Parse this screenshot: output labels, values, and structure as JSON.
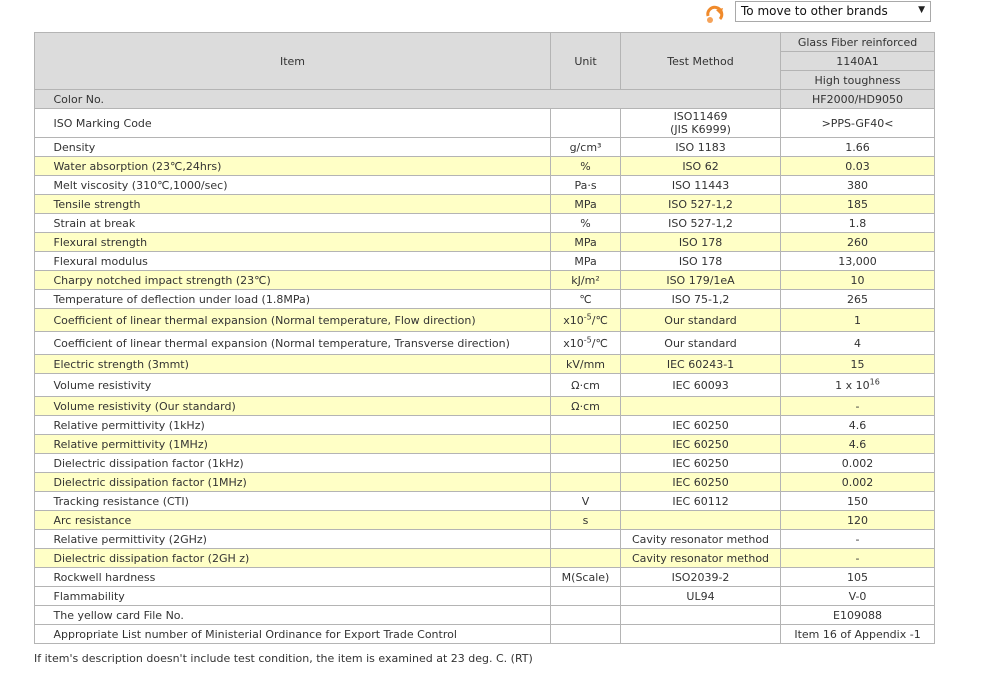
{
  "brand_selector": {
    "icon": "brand-switch-icon",
    "label": "To move to other brands",
    "arrow": "▼"
  },
  "table": {
    "headers": {
      "item": "Item",
      "unit": "Unit",
      "test_method": "Test Method",
      "grade_group": "Glass Fiber reinforced",
      "grade": "1140A1",
      "feature": "High toughness"
    },
    "color_no": {
      "item": "Color No.",
      "value": "HF2000/HD9050"
    },
    "rows": [
      {
        "item": "ISO Marking Code",
        "unit": "",
        "method": "ISO11469",
        "method_sub": "(JIS K6999)",
        "value": ">PPS-GF40<",
        "style": "white",
        "tall": true
      },
      {
        "item": "Density",
        "unit": "g/cm³",
        "method": "ISO 1183",
        "value": "1.66",
        "style": "white"
      },
      {
        "item": "Water absorption (23℃,24hrs)",
        "unit": "%",
        "method": "ISO 62",
        "value": "0.03",
        "style": "yellow"
      },
      {
        "item": "Melt viscosity (310℃,1000/sec)",
        "unit": "Pa·s",
        "method": "ISO 11443",
        "value": "380",
        "style": "white"
      },
      {
        "item": "Tensile strength",
        "unit": "MPa",
        "method": "ISO 527-1,2",
        "value": "185",
        "style": "yellow"
      },
      {
        "item": "Strain at break",
        "unit": "%",
        "method": "ISO 527-1,2",
        "value": "1.8",
        "style": "white"
      },
      {
        "item": "Flexural strength",
        "unit": "MPa",
        "method": "ISO 178",
        "value": "260",
        "style": "yellow"
      },
      {
        "item": "Flexural modulus",
        "unit": "MPa",
        "method": "ISO 178",
        "value": "13,000",
        "style": "white"
      },
      {
        "item": "Charpy notched impact strength (23℃)",
        "unit": "kJ/m²",
        "method": "ISO 179/1eA",
        "value": "10",
        "style": "yellow"
      },
      {
        "item": "Temperature of deflection under load (1.8MPa)",
        "unit": "℃",
        "method": "ISO 75-1,2",
        "value": "265",
        "style": "white"
      },
      {
        "item": "Coefficient of linear thermal expansion (Normal temperature, Flow direction)",
        "unit_base": "x10",
        "unit_exp": "-5",
        "unit_tail": "/℃",
        "method": "Our standard",
        "value": "1",
        "style": "yellow",
        "tall2": true
      },
      {
        "item": "Coefficient of linear thermal expansion (Normal temperature, Transverse direction)",
        "unit_base": "x10",
        "unit_exp": "-5",
        "unit_tail": "/℃",
        "method": "Our standard",
        "value": "4",
        "style": "white",
        "tall2": true
      },
      {
        "item": "Electric strength (3mmt)",
        "unit": "kV/mm",
        "method": "IEC 60243-1",
        "value": "15",
        "style": "yellow"
      },
      {
        "item": "Volume resistivity",
        "unit": "Ω·cm",
        "method": "IEC 60093",
        "value_base": "1 x 10",
        "value_exp": "16",
        "style": "white",
        "tall2": true
      },
      {
        "item": "Volume resistivity (Our standard)",
        "unit": "Ω·cm",
        "method": "",
        "value": "-",
        "style": "yellow"
      },
      {
        "item": "Relative permittivity (1kHz)",
        "unit": "",
        "method": "IEC 60250",
        "value": "4.6",
        "style": "white"
      },
      {
        "item": "Relative permittivity (1MHz)",
        "unit": "",
        "method": "IEC 60250",
        "value": "4.6",
        "style": "yellow"
      },
      {
        "item": "Dielectric dissipation factor (1kHz)",
        "unit": "",
        "method": "IEC 60250",
        "value": "0.002",
        "style": "white"
      },
      {
        "item": "Dielectric dissipation factor (1MHz)",
        "unit": "",
        "method": "IEC 60250",
        "value": "0.002",
        "style": "yellow"
      },
      {
        "item": "Tracking resistance (CTI)",
        "unit": "V",
        "method": "IEC 60112",
        "value": "150",
        "style": "white"
      },
      {
        "item": "Arc resistance",
        "unit": "s",
        "method": "",
        "value": "120",
        "style": "yellow"
      },
      {
        "item": "Relative permittivity (2GHz)",
        "unit": "",
        "method": "Cavity resonator method",
        "value": "-",
        "style": "white"
      },
      {
        "item": "Dielectric dissipation factor (2GH z)",
        "unit": "",
        "method": "Cavity resonator method",
        "value": "-",
        "style": "yellow"
      },
      {
        "item": "Rockwell hardness",
        "unit": "M(Scale)",
        "method": "ISO2039-2",
        "value": "105",
        "style": "white"
      },
      {
        "item": "Flammability",
        "unit": "",
        "method": "UL94",
        "value": "V-0",
        "style": "white"
      },
      {
        "item": "The yellow card File No.",
        "unit": "",
        "method": "",
        "value": "E109088",
        "style": "white"
      },
      {
        "item": "Appropriate List number of Ministerial Ordinance for Export Trade Control",
        "unit": "",
        "method": "",
        "value": "Item 16 of Appendix -1",
        "style": "white"
      }
    ]
  },
  "footnote": "If item's description doesn't include test condition, the item is examined at 23 deg. C. (RT)"
}
